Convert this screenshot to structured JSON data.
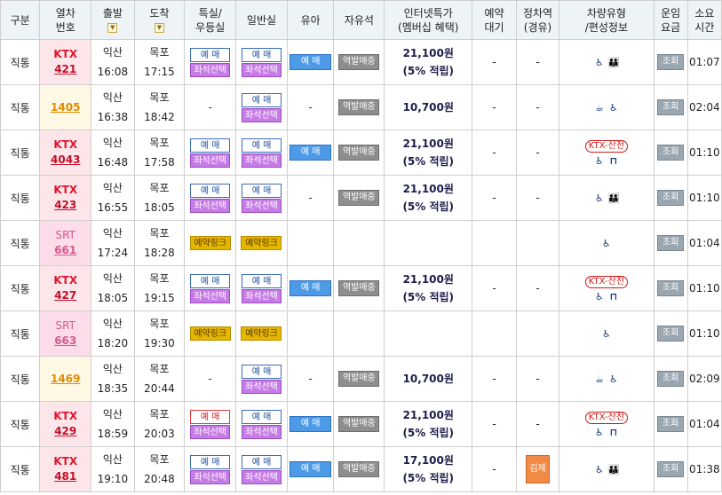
{
  "headers": {
    "category": [
      "구분"
    ],
    "train": [
      "열차",
      "번호"
    ],
    "departure": [
      "출발"
    ],
    "arrival": [
      "도착"
    ],
    "special": [
      "특실/",
      "우등실"
    ],
    "general": [
      "일반실"
    ],
    "baby": [
      "유아"
    ],
    "standing": [
      "자유석"
    ],
    "internet_price": [
      "인터넷특가",
      "(멤버십 혜택)"
    ],
    "reserve_wait": [
      "예약",
      "대기"
    ],
    "via": [
      "정차역",
      "(경유)"
    ],
    "vehicle": [
      "차량유형",
      "/편성정보"
    ],
    "fare": [
      "운임",
      "요금"
    ],
    "duration": [
      "소요",
      "시간"
    ]
  },
  "labels": {
    "reserve": "예 매",
    "seat_select": "좌석선택",
    "reserve_link": "예약링크",
    "baby_reserve": "예 매",
    "standing": "역발매중",
    "fare_lookup": "조회",
    "dash": "-",
    "ktx_sancheon": "KTX-산천",
    "via_stop": "김제"
  },
  "rows": [
    {
      "category": "직통",
      "type": "KTX",
      "number": "421",
      "kind": "ktx",
      "dep_station": "익산",
      "dep_time": "16:08",
      "arr_station": "목포",
      "arr_time": "17:15",
      "special": "reserve",
      "general": "reserve",
      "baby": true,
      "standing": true,
      "price": "21,100원",
      "rate": "(5% 적립)",
      "wait": "-",
      "via": "-",
      "vehicle": "ktx",
      "sancheon": false,
      "duration": "01:07"
    },
    {
      "category": "직통",
      "type": "",
      "number": "1405",
      "kind": "mu",
      "dep_station": "익산",
      "dep_time": "16:38",
      "arr_station": "목포",
      "arr_time": "18:42",
      "special": "none",
      "general": "reserve",
      "baby": false,
      "standing": true,
      "price": "10,700원",
      "rate": "",
      "wait": "-",
      "via": "-",
      "vehicle": "mu",
      "sancheon": false,
      "duration": "02:04"
    },
    {
      "category": "직통",
      "type": "KTX",
      "number": "4043",
      "kind": "ktx",
      "dep_station": "익산",
      "dep_time": "16:48",
      "arr_station": "목포",
      "arr_time": "17:58",
      "special": "reserve",
      "general": "reserve",
      "baby": true,
      "standing": true,
      "price": "21,100원",
      "rate": "(5% 적립)",
      "wait": "-",
      "via": "-",
      "vehicle": "sancheon",
      "sancheon": true,
      "duration": "01:10"
    },
    {
      "category": "직통",
      "type": "KTX",
      "number": "423",
      "kind": "ktx",
      "dep_station": "익산",
      "dep_time": "16:55",
      "arr_station": "목포",
      "arr_time": "18:05",
      "special": "reserve",
      "general": "reserve",
      "baby": false,
      "standing": true,
      "price": "21,100원",
      "rate": "(5% 적립)",
      "wait": "-",
      "via": "-",
      "vehicle": "ktx",
      "sancheon": false,
      "duration": "01:10"
    },
    {
      "category": "직통",
      "type": "SRT",
      "number": "661",
      "kind": "srt",
      "dep_station": "익산",
      "dep_time": "17:24",
      "arr_station": "목포",
      "arr_time": "18:28",
      "special": "link",
      "general": "link",
      "baby": false,
      "standing": false,
      "price": "",
      "rate": "",
      "wait": "",
      "via": "",
      "vehicle": "srt",
      "sancheon": false,
      "duration": "01:04"
    },
    {
      "category": "직통",
      "type": "KTX",
      "number": "427",
      "kind": "ktx",
      "dep_station": "익산",
      "dep_time": "18:05",
      "arr_station": "목포",
      "arr_time": "19:15",
      "special": "reserve",
      "general": "reserve",
      "baby": true,
      "standing": true,
      "price": "21,100원",
      "rate": "(5% 적립)",
      "wait": "-",
      "via": "-",
      "vehicle": "sancheon",
      "sancheon": true,
      "duration": "01:10"
    },
    {
      "category": "직통",
      "type": "SRT",
      "number": "663",
      "kind": "srt",
      "dep_station": "익산",
      "dep_time": "18:20",
      "arr_station": "목포",
      "arr_time": "19:30",
      "special": "link",
      "general": "link",
      "baby": false,
      "standing": false,
      "price": "",
      "rate": "",
      "wait": "",
      "via": "",
      "vehicle": "srt",
      "sancheon": false,
      "duration": "01:10"
    },
    {
      "category": "직통",
      "type": "",
      "number": "1469",
      "kind": "mu",
      "dep_station": "익산",
      "dep_time": "18:35",
      "arr_station": "목포",
      "arr_time": "20:44",
      "special": "none",
      "general": "reserve",
      "baby": false,
      "standing": true,
      "price": "10,700원",
      "rate": "",
      "wait": "-",
      "via": "-",
      "vehicle": "mu",
      "sancheon": false,
      "duration": "02:09"
    },
    {
      "category": "직통",
      "type": "KTX",
      "number": "429",
      "kind": "ktx",
      "dep_station": "익산",
      "dep_time": "18:59",
      "arr_station": "목포",
      "arr_time": "20:03",
      "special": "reserve-red",
      "general": "reserve",
      "baby": true,
      "standing": true,
      "price": "21,100원",
      "rate": "(5% 적립)",
      "wait": "-",
      "via": "-",
      "vehicle": "sancheon",
      "sancheon": true,
      "duration": "01:04"
    },
    {
      "category": "직통",
      "type": "KTX",
      "number": "481",
      "kind": "ktx",
      "dep_station": "익산",
      "dep_time": "19:10",
      "arr_station": "목포",
      "arr_time": "20:48",
      "special": "reserve",
      "general": "reserve",
      "baby": true,
      "standing": true,
      "price": "17,100원",
      "rate": "(5% 적립)",
      "wait": "-",
      "via": "김제",
      "vehicle": "ktx",
      "sancheon": false,
      "duration": "01:38"
    }
  ]
}
